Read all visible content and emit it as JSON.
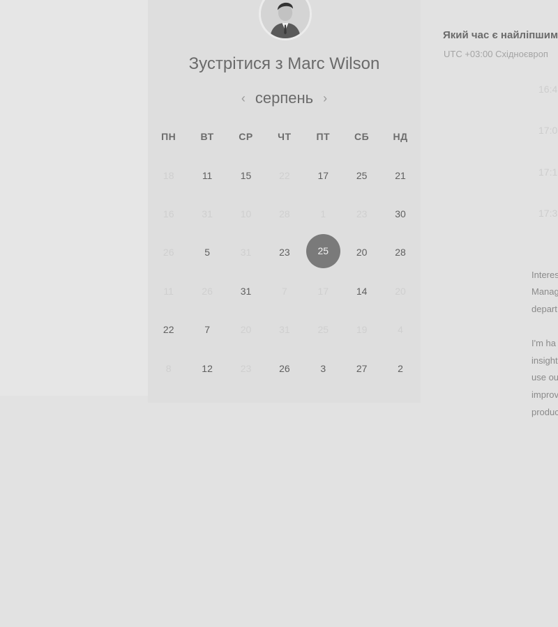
{
  "host": {
    "title": "Зустрітися з Marc Wilson"
  },
  "calendar": {
    "month": "серпень",
    "prev_icon": "chevron-left-icon",
    "next_icon": "chevron-right-icon",
    "weekdays": [
      "ПН",
      "ВТ",
      "СР",
      "ЧТ",
      "ПТ",
      "СБ",
      "НД"
    ],
    "weeks": [
      [
        {
          "d": "18",
          "m": true
        },
        {
          "d": "11",
          "m": false
        },
        {
          "d": "15",
          "m": false
        },
        {
          "d": "22",
          "m": true
        },
        {
          "d": "17",
          "m": false
        },
        {
          "d": "25",
          "m": false
        },
        {
          "d": "21",
          "m": false
        }
      ],
      [
        {
          "d": "16",
          "m": true
        },
        {
          "d": "31",
          "m": true
        },
        {
          "d": "10",
          "m": true
        },
        {
          "d": "28",
          "m": true
        },
        {
          "d": "1",
          "m": true
        },
        {
          "d": "23",
          "m": true
        },
        {
          "d": "30",
          "m": false
        }
      ],
      [
        {
          "d": "26",
          "m": true
        },
        {
          "d": "5",
          "m": false
        },
        {
          "d": "31",
          "m": true
        },
        {
          "d": "23",
          "m": false
        },
        {
          "d": "25",
          "m": false,
          "selected": true
        },
        {
          "d": "20",
          "m": false
        },
        {
          "d": "28",
          "m": false
        }
      ],
      [
        {
          "d": "11",
          "m": true
        },
        {
          "d": "26",
          "m": true
        },
        {
          "d": "31",
          "m": false
        },
        {
          "d": "7",
          "m": true
        },
        {
          "d": "17",
          "m": true
        },
        {
          "d": "14",
          "m": false
        },
        {
          "d": "20",
          "m": true
        }
      ],
      [
        {
          "d": "22",
          "m": false
        },
        {
          "d": "7",
          "m": false
        },
        {
          "d": "20",
          "m": true
        },
        {
          "d": "31",
          "m": true
        },
        {
          "d": "25",
          "m": true
        },
        {
          "d": "19",
          "m": true
        },
        {
          "d": "4",
          "m": true
        }
      ],
      [
        {
          "d": "8",
          "m": true
        },
        {
          "d": "12",
          "m": false
        },
        {
          "d": "23",
          "m": true
        },
        {
          "d": "26",
          "m": false
        },
        {
          "d": "3",
          "m": false
        },
        {
          "d": "27",
          "m": false
        },
        {
          "d": "2",
          "m": false
        }
      ]
    ]
  },
  "schedule": {
    "heading": "Який час є найліпшим",
    "timezone": "UTC +03:00 Східноєвроп",
    "slots": [
      "16:4",
      "17:0",
      "17:1",
      "17:3"
    ]
  },
  "bio": {
    "lines": [
      "Interes",
      "Manag",
      "depart",
      "",
      "I'm ha",
      "insight",
      "use ou",
      "improv",
      "produc"
    ]
  }
}
